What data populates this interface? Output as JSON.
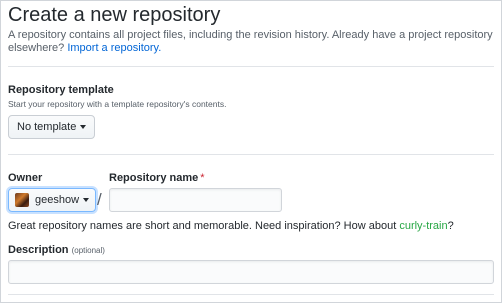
{
  "header": {
    "title": "Create a new repository",
    "subtitle": "A repository contains all project files, including the revision history. Already have a project repository elsewhere?",
    "import_link": "Import a repository."
  },
  "template": {
    "heading": "Repository template",
    "note": "Start your repository with a template repository's contents.",
    "button_label": "No template"
  },
  "owner": {
    "label": "Owner",
    "value": "geeshow",
    "avatar_icon": "user-avatar"
  },
  "separator": "/",
  "repo_name": {
    "label": "Repository name",
    "required_marker": "*",
    "value": "",
    "placeholder": ""
  },
  "hint": {
    "text": "Great repository names are short and memorable. Need inspiration? How about",
    "suggestion": "curly-train",
    "suffix": "?"
  },
  "description": {
    "label": "Description",
    "optional": "(optional)",
    "value": ""
  },
  "colors": {
    "link": "#0366d6",
    "suggestion": "#28a745",
    "required": "#cb2431",
    "focus": "#79b8ff"
  }
}
